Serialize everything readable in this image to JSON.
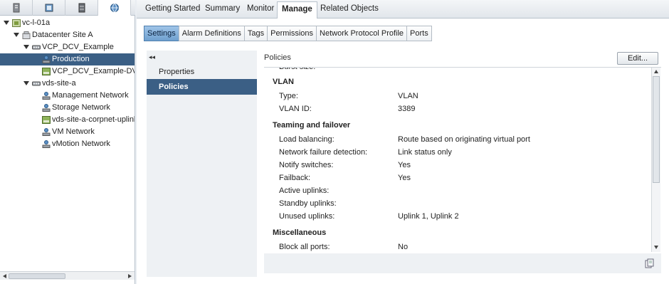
{
  "nav": {
    "tabs": [
      {
        "icon": "hosts-clusters-icon"
      },
      {
        "icon": "vms-templates-icon"
      },
      {
        "icon": "storage-icon"
      },
      {
        "icon": "networking-icon"
      }
    ],
    "tree": [
      {
        "label": "vc-l-01a",
        "level": 0,
        "icon": "vcenter",
        "expanded": true
      },
      {
        "label": "Datacenter Site A",
        "level": 1,
        "icon": "datacenter",
        "expanded": true
      },
      {
        "label": "VCP_DCV_Example",
        "level": 2,
        "icon": "vds",
        "expanded": true
      },
      {
        "label": "Production",
        "level": 3,
        "icon": "portgroup",
        "selected": true
      },
      {
        "label": "VCP_DCV_Example-DV",
        "level": 3,
        "icon": "uplink"
      },
      {
        "label": "vds-site-a",
        "level": 2,
        "icon": "vds",
        "expanded": true
      },
      {
        "label": "Management Network",
        "level": 3,
        "icon": "portgroup"
      },
      {
        "label": "Storage Network",
        "level": 3,
        "icon": "portgroup"
      },
      {
        "label": "vds-site-a-corpnet-uplink",
        "level": 3,
        "icon": "uplink"
      },
      {
        "label": "VM Network",
        "level": 3,
        "icon": "portgroup"
      },
      {
        "label": "vMotion Network",
        "level": 3,
        "icon": "portgroup"
      }
    ]
  },
  "top_tabs": [
    "Getting Started",
    "Summary",
    "Monitor",
    "Manage",
    "Related Objects"
  ],
  "active_top_tab": "Manage",
  "sub_tabs": [
    "Settings",
    "Alarm Definitions",
    "Tags",
    "Permissions",
    "Network Protocol Profile",
    "Ports"
  ],
  "active_sub_tab": "Settings",
  "inner_nav": {
    "collapse_glyph": "◂◂",
    "items": [
      "Properties",
      "Policies"
    ],
    "active": "Policies"
  },
  "policies": {
    "title": "Policies",
    "edit_label": "Edit...",
    "cut_row": "Burst size:",
    "sections": [
      {
        "title": "VLAN",
        "rows": [
          {
            "key": "Type:",
            "value": "VLAN"
          },
          {
            "key": "VLAN ID:",
            "value": "3389"
          }
        ]
      },
      {
        "title": "Teaming and failover",
        "rows": [
          {
            "key": "Load balancing:",
            "value": "Route based on originating virtual port"
          },
          {
            "key": "Network failure detection:",
            "value": "Link status only"
          },
          {
            "key": "Notify switches:",
            "value": "Yes"
          },
          {
            "key": "Failback:",
            "value": "Yes"
          },
          {
            "key": "Active uplinks:",
            "value": ""
          },
          {
            "key": "Standby uplinks:",
            "value": ""
          },
          {
            "key": "Unused uplinks:",
            "value": "Uplink 1, Uplink 2"
          }
        ]
      },
      {
        "title": "Miscellaneous",
        "rows": [
          {
            "key": "Block all ports:",
            "value": "No"
          }
        ]
      }
    ],
    "footer_icon": "export-list-icon"
  },
  "colors": {
    "selection": "#3b5f85",
    "subtab_active": "#6fa0cf",
    "panel_bg": "#eef1f4"
  }
}
